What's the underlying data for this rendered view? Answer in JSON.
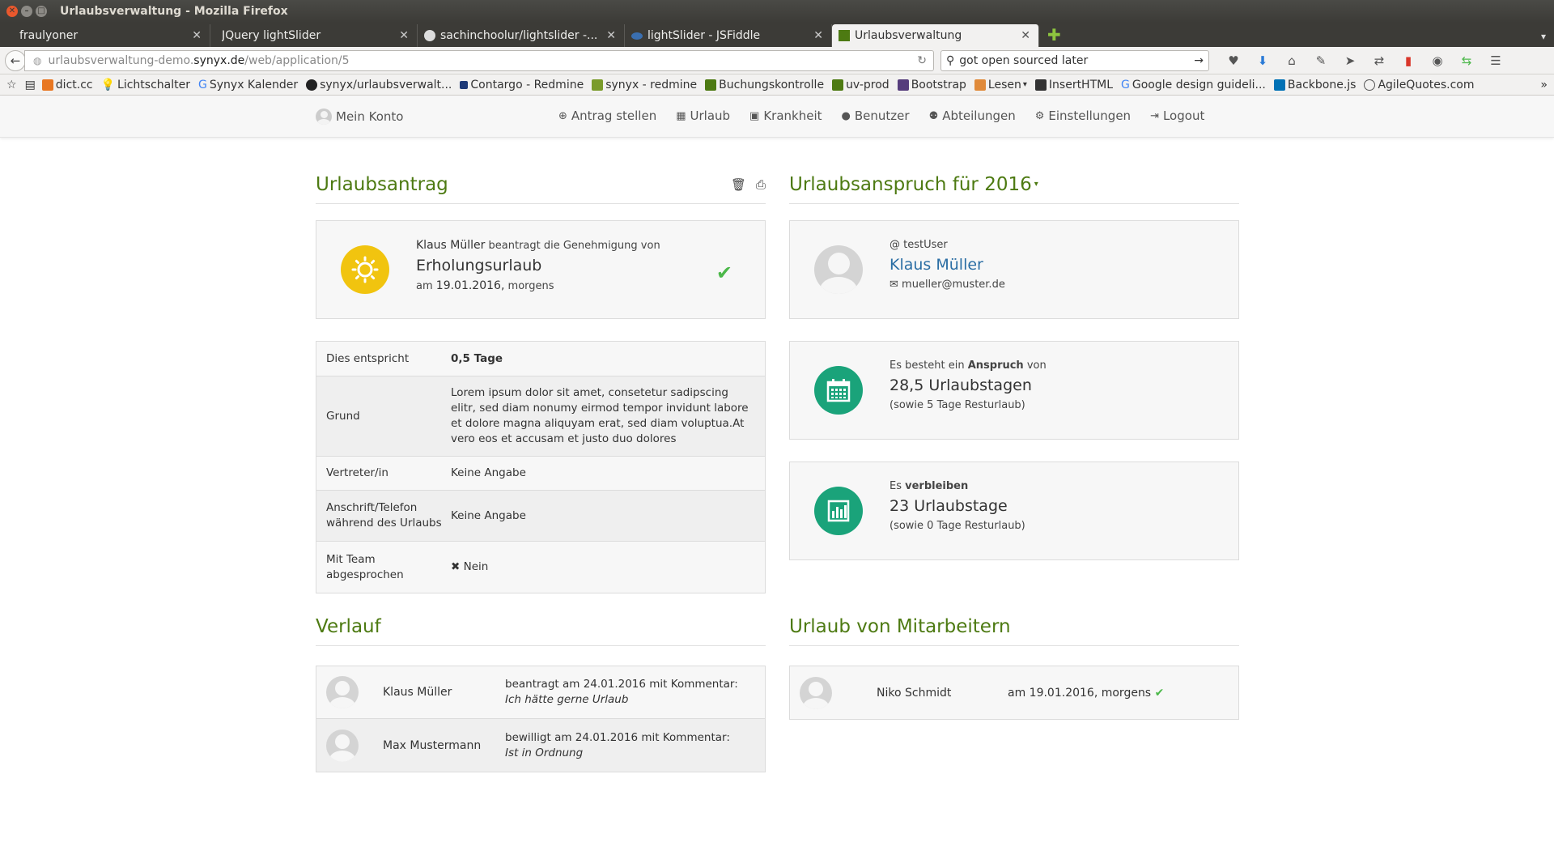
{
  "window": {
    "title": "Urlaubsverwaltung - Mozilla Firefox"
  },
  "tabs": [
    {
      "label": "fraulyoner"
    },
    {
      "label": "JQuery lightSlider"
    },
    {
      "label": "sachinchoolur/lightslider -..."
    },
    {
      "label": "lightSlider - JSFiddle"
    },
    {
      "label": "Urlaubsverwaltung"
    }
  ],
  "urlbar": {
    "host_prefix": "urlaubsverwaltung-demo.",
    "host": "synyx.de",
    "path": "/web/application/5"
  },
  "searchbar": {
    "value": "got open sourced later"
  },
  "bookmarks": [
    "dict.cc",
    "Lichtschalter",
    "Synyx Kalender",
    "synyx/urlaubsverwalt...",
    "Contargo - Redmine",
    "synyx - redmine",
    "Buchungskontrolle",
    "uv-prod",
    "Bootstrap",
    "Lesen",
    "InsertHTML",
    "Google design guideli...",
    "Backbone.js",
    "AgileQuotes.com"
  ],
  "appnav": {
    "konto": "Mein Konto",
    "items": [
      "Antrag stellen",
      "Urlaub",
      "Krankheit",
      "Benutzer",
      "Abteilungen",
      "Einstellungen",
      "Logout"
    ]
  },
  "antrag": {
    "title": "Urlaubsantrag",
    "person": "Klaus Müller",
    "action": "beantragt die Genehmigung von",
    "type": "Erholungsurlaub",
    "date_prefix": "am",
    "date": "19.01.2016,",
    "daytime": "morgens"
  },
  "details": [
    {
      "label": "Dies entspricht",
      "value": "0,5 Tage"
    },
    {
      "label": "Grund",
      "value": "Lorem ipsum dolor sit amet, consetetur sadipscing elitr, sed diam nonumy eirmod tempor invidunt labore et dolore magna aliquyam erat, sed diam voluptua.At vero eos et accusam et justo duo dolores"
    },
    {
      "label": "Vertreter/in",
      "value": "Keine Angabe"
    },
    {
      "label": "Anschrift/Telefon während des Urlaubs",
      "value": "Keine Angabe"
    },
    {
      "label": "Mit Team abgesprochen",
      "value": "Nein"
    }
  ],
  "anspruch": {
    "title": "Urlaubsanspruch für 2016",
    "username": "testUser",
    "name": "Klaus Müller",
    "email": "mueller@muster.de",
    "claim_pre": "Es besteht ein",
    "claim_bold": "Anspruch",
    "claim_post": "von",
    "claim_value": "28,5 Urlaubstagen",
    "claim_note": "(sowie 5 Tage Resturlaub)",
    "remain_pre": "Es",
    "remain_bold": "verbleiben",
    "remain_value": "23 Urlaubstage",
    "remain_note": "(sowie 0 Tage Resturlaub)"
  },
  "verlauf": {
    "title": "Verlauf",
    "rows": [
      {
        "name": "Klaus Müller",
        "text": "beantragt am 24.01.2016 mit Kommentar:",
        "comment": "Ich hätte gerne Urlaub"
      },
      {
        "name": "Max Mustermann",
        "text": "bewilligt am 24.01.2016 mit Kommentar:",
        "comment": "Ist in Ordnung"
      }
    ]
  },
  "mitarbeiter": {
    "title": "Urlaub von Mitarbeitern",
    "rows": [
      {
        "name": "Niko Schmidt",
        "date": "am 19.01.2016, morgens"
      }
    ]
  },
  "colors": {
    "green_title": "#4d7a12",
    "sun": "#f1c40f",
    "teal": "#1aa37a",
    "check": "#4cb84a",
    "link": "#2b6ea4"
  }
}
